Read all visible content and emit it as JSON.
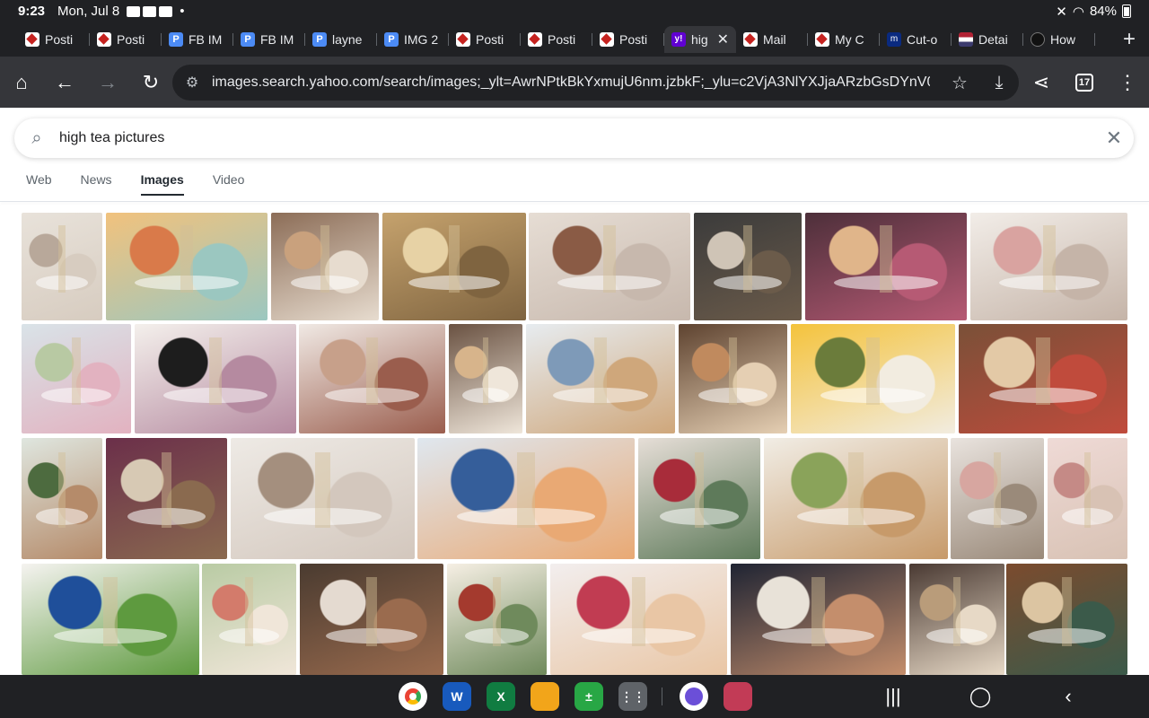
{
  "status": {
    "time": "9:23",
    "date": "Mon, Jul 8",
    "dot": "•",
    "battery": "84%"
  },
  "tabs": [
    {
      "label": "Posti",
      "fav": "red"
    },
    {
      "label": "Posti",
      "fav": "red"
    },
    {
      "label": "FB IM",
      "fav": "blue"
    },
    {
      "label": "FB IM",
      "fav": "blue"
    },
    {
      "label": "layne",
      "fav": "blue"
    },
    {
      "label": "IMG 2",
      "fav": "blue"
    },
    {
      "label": "Posti",
      "fav": "red"
    },
    {
      "label": "Posti",
      "fav": "red"
    },
    {
      "label": "Posti",
      "fav": "red"
    },
    {
      "label": "hig",
      "fav": "yahoo",
      "active": true
    },
    {
      "label": "Mail",
      "fav": "red"
    },
    {
      "label": "My C",
      "fav": "red"
    },
    {
      "label": "Cut-o",
      "fav": "dark"
    },
    {
      "label": "Detai",
      "fav": "flag"
    },
    {
      "label": "How",
      "fav": "round"
    }
  ],
  "toolbar": {
    "url": "images.search.yahoo.com/search/images;_ylt=AwrNPtkBkYxmujU6nm.jzbkF;_ylu=c2VjA3NlYXJjaARzbGsDYnV0",
    "tab_count": "17"
  },
  "search": {
    "query": "high tea pictures"
  },
  "nav": {
    "web": "Web",
    "news": "News",
    "images": "Images",
    "video": "Video"
  },
  "colors": {
    "accent_purple": "#6001d2",
    "chrome_dark": "#202124",
    "toolbar": "#35363a"
  },
  "images": [
    {
      "name": "high tea stand with cups",
      "palette": [
        "#e8e2da",
        "#b8a89a",
        "#d7ccc0"
      ]
    },
    {
      "name": "colorful cakes on table",
      "palette": [
        "#f1c27d",
        "#d97a4a",
        "#9bc7c0"
      ]
    },
    {
      "name": "tiered stand with pastries",
      "palette": [
        "#8c6d57",
        "#c9a17d",
        "#e7dccf"
      ]
    },
    {
      "name": "tea set on floral background",
      "palette": [
        "#c5a26d",
        "#e7d2a5",
        "#7f6440"
      ]
    },
    {
      "name": "teacup and cakes on table",
      "palette": [
        "#e6ddd4",
        "#8a5b45",
        "#c7b8ad"
      ]
    },
    {
      "name": "dark table with tea stands",
      "palette": [
        "#3b3b3b",
        "#cfc4b6",
        "#6b5b4a"
      ]
    },
    {
      "name": "tiered stand with desserts",
      "palette": [
        "#4d2f3a",
        "#e0b58a",
        "#b65a74"
      ]
    },
    {
      "name": "champagne and tea stand",
      "palette": [
        "#f2ede8",
        "#d9a3a0",
        "#c5b4a8"
      ]
    },
    {
      "name": "pastel tea table",
      "palette": [
        "#d9e3e8",
        "#b8c9a3",
        "#e2b2c0"
      ]
    },
    {
      "name": "white teapot and macarons",
      "palette": [
        "#f4f0ec",
        "#1d1d1d",
        "#b58aa0"
      ]
    },
    {
      "name": "tea stand with sandwiches",
      "palette": [
        "#f0e9e4",
        "#c7a08a",
        "#9a5d4d"
      ]
    },
    {
      "name": "small tiered stand",
      "palette": [
        "#6a5242",
        "#d7b48b",
        "#efe6da"
      ]
    },
    {
      "name": "blue and white china tea",
      "palette": [
        "#e7ecf0",
        "#7e9ab8",
        "#cfa77b"
      ]
    },
    {
      "name": "pastries and cookies",
      "palette": [
        "#5e4330",
        "#c08a5e",
        "#e5cfb3"
      ]
    },
    {
      "name": "yellow flowers high tea",
      "palette": [
        "#f4c33c",
        "#6b7c3b",
        "#f2ece0"
      ]
    },
    {
      "name": "sandwich tray",
      "palette": [
        "#7a5038",
        "#e3c9a6",
        "#c04b3c"
      ]
    },
    {
      "name": "garden tea stand",
      "palette": [
        "#dfe6df",
        "#4d6b3f",
        "#b58b6a"
      ]
    },
    {
      "name": "purple booth tea stand",
      "palette": [
        "#6b2f4a",
        "#d7c9b4",
        "#8a6a4f"
      ]
    },
    {
      "name": "silver teapot and plates",
      "palette": [
        "#eeeae5",
        "#a48f7e",
        "#d3c7bd"
      ]
    },
    {
      "name": "blue willow tea service",
      "palette": [
        "#dfe7ef",
        "#355e9a",
        "#e9a974"
      ]
    },
    {
      "name": "red velvet cupcakes",
      "palette": [
        "#e6ded7",
        "#a82c3a",
        "#5e7a5a"
      ]
    },
    {
      "name": "tea on wooden table",
      "palette": [
        "#f1ede5",
        "#8aa35a",
        "#c79a6a"
      ]
    },
    {
      "name": "floral tea table",
      "palette": [
        "#e9e3de",
        "#d7a6a0",
        "#9a8a7a"
      ]
    },
    {
      "name": "rose tiered stand",
      "palette": [
        "#efdad6",
        "#c58a86",
        "#d8c2b4"
      ]
    },
    {
      "name": "blue teapot sandwiches",
      "palette": [
        "#f5f3f0",
        "#1f4f9a",
        "#5e9a3f"
      ]
    },
    {
      "name": "outdoor tea stand",
      "palette": [
        "#b9cba4",
        "#d37b6b",
        "#f0e6d9"
      ]
    },
    {
      "name": "white teapot with stand",
      "palette": [
        "#4a3b30",
        "#e4dad0",
        "#9a6b4e"
      ]
    },
    {
      "name": "afternoon tea guide",
      "palette": [
        "#f6efe4",
        "#a43a2e",
        "#6f8a5c"
      ]
    },
    {
      "name": "dessert platter",
      "palette": [
        "#f2eeee",
        "#c13c52",
        "#e9c6a5"
      ]
    },
    {
      "name": "dark tray with sweets",
      "palette": [
        "#1f2433",
        "#e8e2d8",
        "#c48e6c"
      ]
    },
    {
      "name": "tall tea stand dim",
      "palette": [
        "#4a3a33",
        "#b99c7a",
        "#e7d9c6"
      ]
    },
    {
      "name": "restaurant tea stand",
      "palette": [
        "#7b4b2e",
        "#dcc5a2",
        "#3b5a4a"
      ]
    }
  ]
}
